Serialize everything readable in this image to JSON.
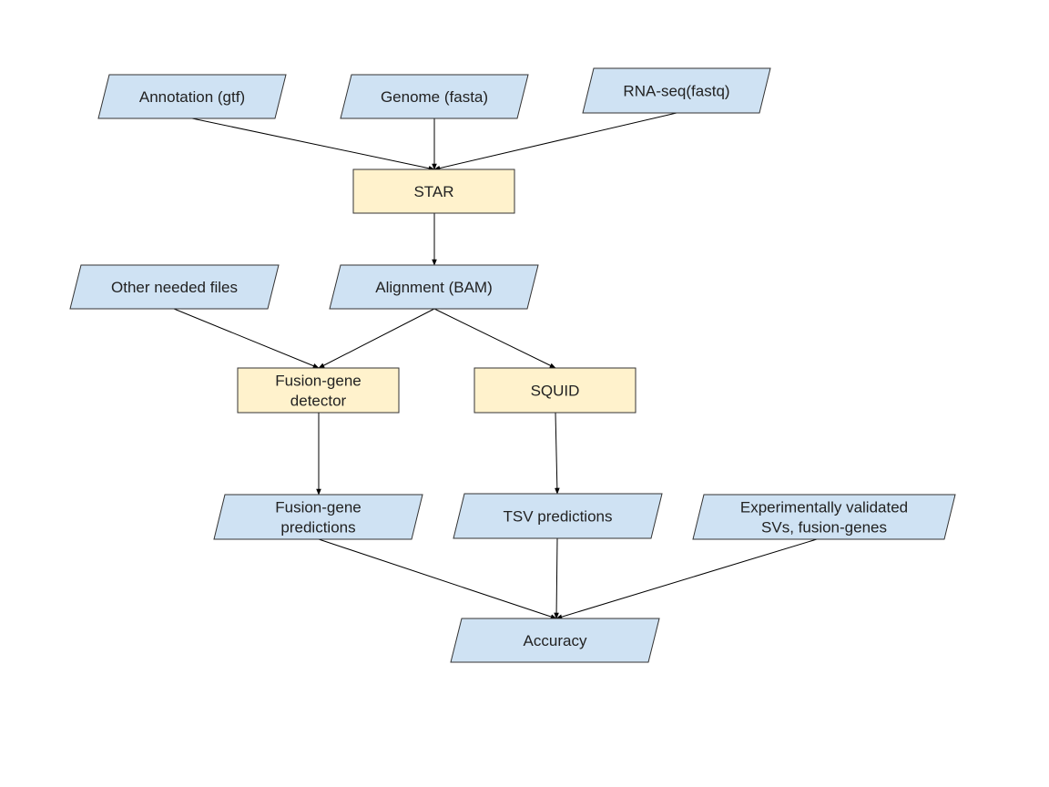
{
  "diagram": {
    "colors": {
      "data_fill": "#cfe2f3",
      "process_fill": "#fff2cc",
      "stroke": "#333333",
      "edge": "#000000"
    },
    "nodes": [
      {
        "id": "annotation",
        "type": "data",
        "lines": [
          "Annotation (gtf)"
        ]
      },
      {
        "id": "genome",
        "type": "data",
        "lines": [
          "Genome (fasta)"
        ]
      },
      {
        "id": "rnaseq",
        "type": "data",
        "lines": [
          "RNA-seq(fastq)"
        ]
      },
      {
        "id": "star",
        "type": "process",
        "lines": [
          "STAR"
        ]
      },
      {
        "id": "other",
        "type": "data",
        "lines": [
          "Other needed files"
        ]
      },
      {
        "id": "alignment",
        "type": "data",
        "lines": [
          "Alignment (BAM)"
        ]
      },
      {
        "id": "fusion_detector",
        "type": "process",
        "lines": [
          "Fusion-gene",
          "detector"
        ]
      },
      {
        "id": "squid",
        "type": "process",
        "lines": [
          "SQUID"
        ]
      },
      {
        "id": "fusion_predictions",
        "type": "data",
        "lines": [
          "Fusion-gene",
          "predictions"
        ]
      },
      {
        "id": "tsv_predictions",
        "type": "data",
        "lines": [
          "TSV predictions"
        ]
      },
      {
        "id": "validated",
        "type": "data",
        "lines": [
          "Experimentally validated",
          "SVs, fusion-genes"
        ]
      },
      {
        "id": "accuracy",
        "type": "data",
        "lines": [
          "Accuracy"
        ]
      }
    ],
    "edges": [
      {
        "from": "annotation",
        "to": "star"
      },
      {
        "from": "genome",
        "to": "star"
      },
      {
        "from": "rnaseq",
        "to": "star"
      },
      {
        "from": "star",
        "to": "alignment"
      },
      {
        "from": "other",
        "to": "fusion_detector"
      },
      {
        "from": "alignment",
        "to": "fusion_detector"
      },
      {
        "from": "alignment",
        "to": "squid"
      },
      {
        "from": "fusion_detector",
        "to": "fusion_predictions"
      },
      {
        "from": "squid",
        "to": "tsv_predictions"
      },
      {
        "from": "fusion_predictions",
        "to": "accuracy"
      },
      {
        "from": "tsv_predictions",
        "to": "accuracy"
      },
      {
        "from": "validated",
        "to": "accuracy"
      }
    ]
  }
}
